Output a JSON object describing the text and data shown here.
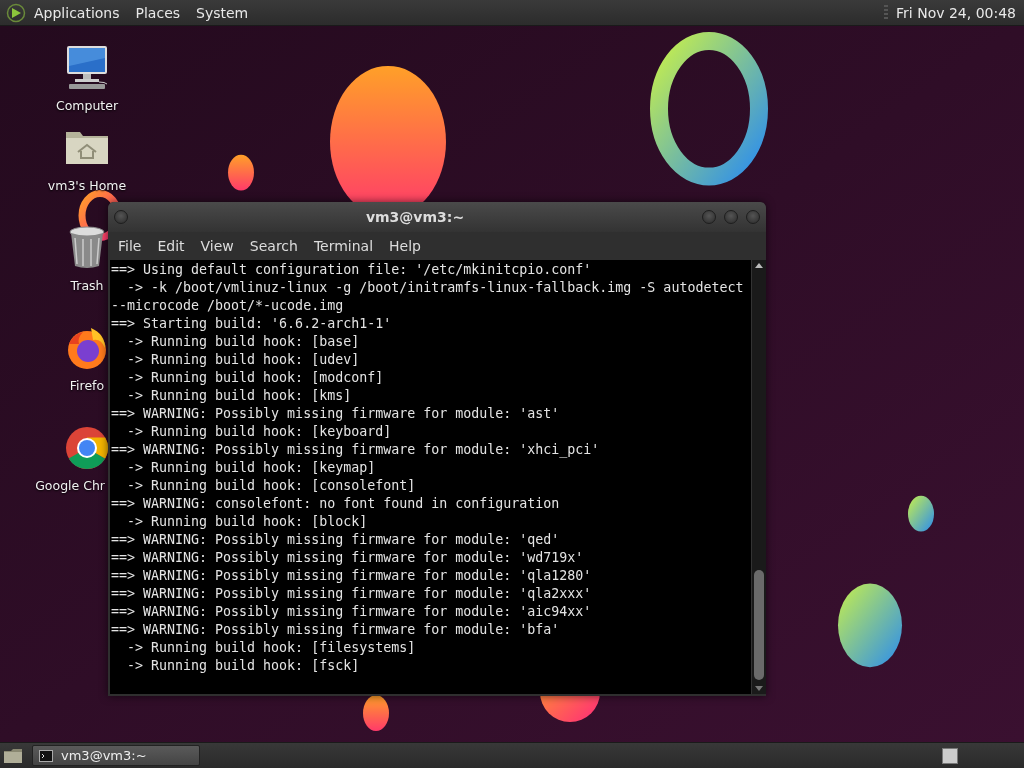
{
  "top_panel": {
    "menus": [
      "Applications",
      "Places",
      "System"
    ],
    "clock": "Fri Nov 24, 00:48"
  },
  "desktop_icons": [
    {
      "kind": "computer",
      "label": "Computer"
    },
    {
      "kind": "home",
      "label": "vm3's Home"
    },
    {
      "kind": "trash",
      "label": "Trash"
    },
    {
      "kind": "firefox",
      "label": "Firefo"
    },
    {
      "kind": "chrome",
      "label": "Google Chr"
    }
  ],
  "window": {
    "title": "vm3@vm3:~",
    "menu": [
      "File",
      "Edit",
      "View",
      "Search",
      "Terminal",
      "Help"
    ],
    "lines": [
      "==> Using default configuration file: '/etc/mkinitcpio.conf'",
      "  -> -k /boot/vmlinuz-linux -g /boot/initramfs-linux-fallback.img -S autodetect",
      "--microcode /boot/*-ucode.img",
      "==> Starting build: '6.6.2-arch1-1'",
      "  -> Running build hook: [base]",
      "  -> Running build hook: [udev]",
      "  -> Running build hook: [modconf]",
      "  -> Running build hook: [kms]",
      "==> WARNING: Possibly missing firmware for module: 'ast'",
      "  -> Running build hook: [keyboard]",
      "==> WARNING: Possibly missing firmware for module: 'xhci_pci'",
      "  -> Running build hook: [keymap]",
      "  -> Running build hook: [consolefont]",
      "==> WARNING: consolefont: no font found in configuration",
      "  -> Running build hook: [block]",
      "==> WARNING: Possibly missing firmware for module: 'qed'",
      "==> WARNING: Possibly missing firmware for module: 'wd719x'",
      "==> WARNING: Possibly missing firmware for module: 'qla1280'",
      "==> WARNING: Possibly missing firmware for module: 'qla2xxx'",
      "==> WARNING: Possibly missing firmware for module: 'aic94xx'",
      "==> WARNING: Possibly missing firmware for module: 'bfa'",
      "  -> Running build hook: [filesystems]",
      "  -> Running build hook: [fsck]"
    ]
  },
  "taskbar": {
    "tasks": [
      {
        "label": "vm3@vm3:~",
        "selected": true
      }
    ]
  }
}
